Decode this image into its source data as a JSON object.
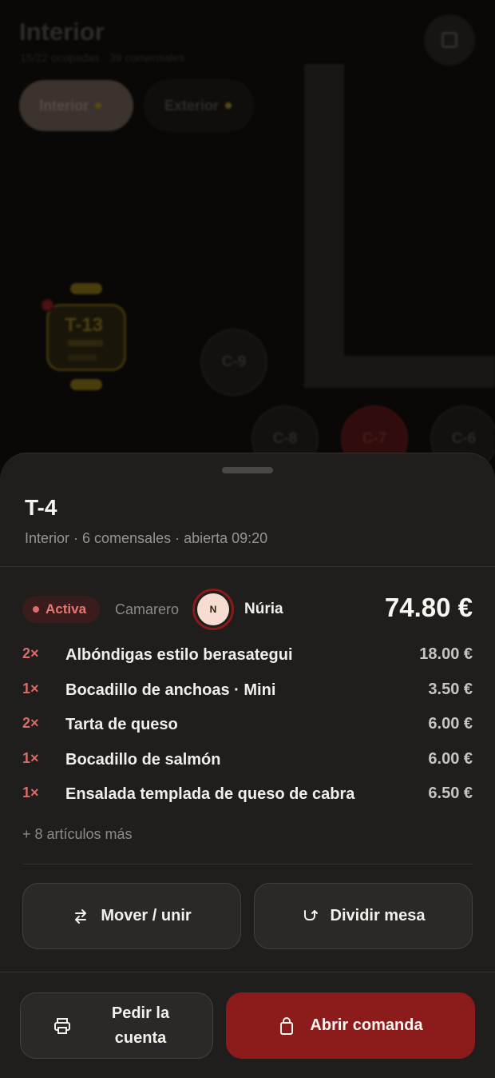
{
  "background": {
    "title": "Interior",
    "subtitle": "15/22 ocupadas · 39 comensales",
    "tabs": [
      {
        "label": "Interior",
        "active": true
      },
      {
        "label": "Exterior",
        "active": false
      }
    ],
    "tables": [
      {
        "label": "T-13"
      },
      {
        "label": "C-9"
      },
      {
        "label": "C-8"
      },
      {
        "label": "C-7"
      },
      {
        "label": "C-6"
      }
    ]
  },
  "sheet": {
    "title": "T-4",
    "subtitle": "Interior · 6 comensales · abierta 09:20",
    "status": "Activa",
    "waiter_label": "Camarero",
    "waiter_initial": "N",
    "waiter_name": "Núria",
    "total": "74.80 €",
    "items": [
      {
        "qty": "2×",
        "name": "Albóndigas estilo berasategui",
        "price": "18.00 €"
      },
      {
        "qty": "1×",
        "name": "Bocadillo de anchoas · Mini",
        "price": "3.50 €"
      },
      {
        "qty": "2×",
        "name": "Tarta de queso",
        "price": "6.00 €"
      },
      {
        "qty": "1×",
        "name": "Bocadillo de salmón",
        "price": "6.00 €"
      },
      {
        "qty": "1×",
        "name": "Ensalada templada de queso de cabra",
        "price": "6.50 €"
      }
    ],
    "more_items": "+ 8 artículos más",
    "actions": {
      "move_label": "Mover / unir",
      "split_label": "Dividir mesa",
      "bill_label_1": "Pedir la",
      "bill_label_2": "cuenta",
      "open_label": "Abrir comanda"
    }
  },
  "colors": {
    "accent": "#8c1b1b",
    "status_text": "#e47775",
    "sheet_bg": "#1f1e1c"
  }
}
